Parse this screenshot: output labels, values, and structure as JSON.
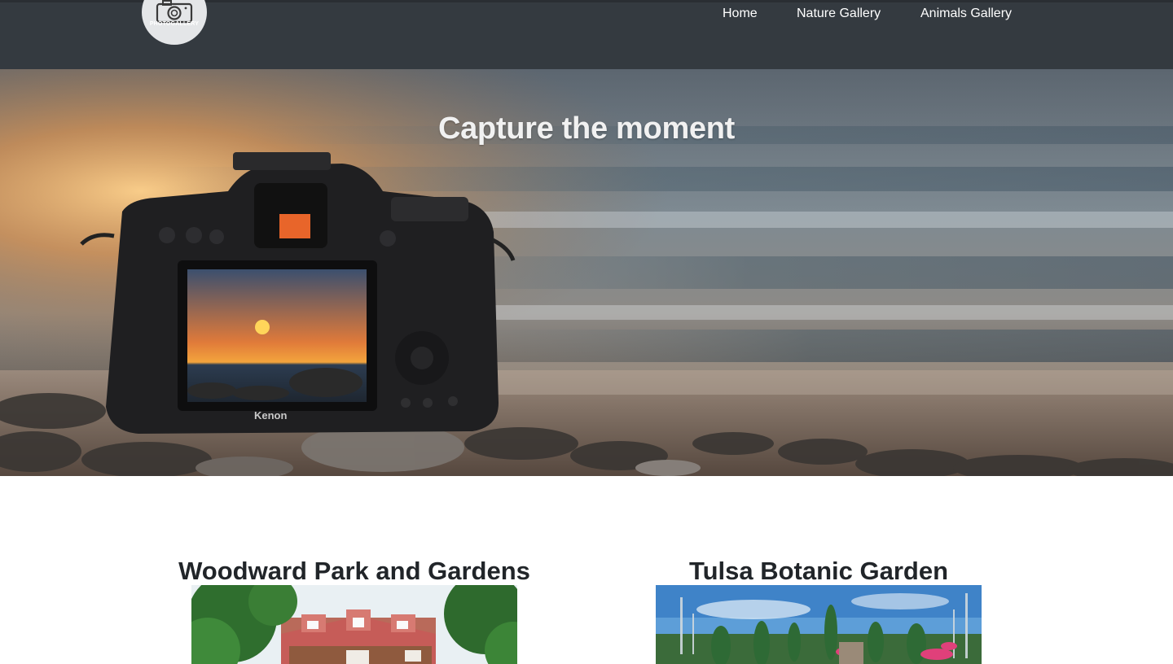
{
  "brand": {
    "logo_text": "PHOTOGALLERY",
    "logo_icon": "camera-icon"
  },
  "nav": {
    "items": [
      {
        "label": "Home"
      },
      {
        "label": "Nature Gallery"
      },
      {
        "label": "Animals Gallery"
      }
    ]
  },
  "hero": {
    "title": "Capture the moment",
    "image": "camera-on-beach-at-sunset",
    "camera_brand_text": "Kenon"
  },
  "gallery": {
    "cards": [
      {
        "title": "Woodward Park and Gardens",
        "image": "woodward-park-house-photo"
      },
      {
        "title": "Tulsa Botanic Garden",
        "image": "tulsa-botanic-garden-photo"
      }
    ]
  },
  "colors": {
    "navbar_bg": "#343a40",
    "nav_text": "#ffffff",
    "page_bg": "#ffffff",
    "heading_text": "#212529"
  }
}
